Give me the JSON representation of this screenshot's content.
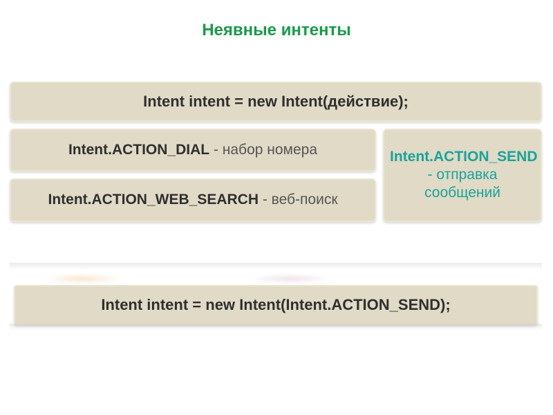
{
  "title": "Неявные интенты",
  "top_card": "Intent intent = new Intent(действие);",
  "left": {
    "dial_bold": "Intent.ACTION_DIAL",
    "dial_rest": " - набор номера",
    "web_bold": "Intent.ACTION_WEB_SEARCH",
    "web_rest": " - веб-поиск"
  },
  "right": {
    "send_bold": "Intent.ACTION_SEND",
    "send_rest": " - отправка сообщений"
  },
  "bottom_card": "Intent intent = new Intent(Intent.ACTION_SEND);"
}
